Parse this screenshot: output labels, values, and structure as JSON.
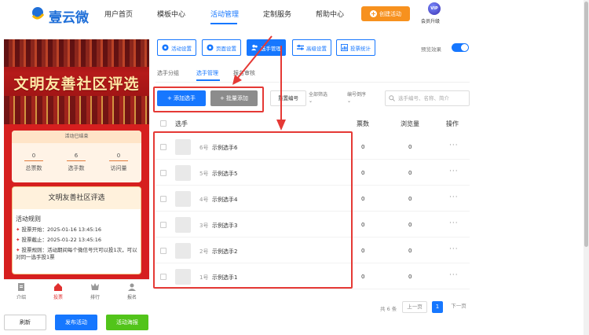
{
  "brand": {
    "name": "壹云微"
  },
  "nav": {
    "items": [
      "用户首页",
      "模板中心",
      "活动管理",
      "定制服务",
      "帮助中心"
    ],
    "active_index": 2,
    "create_label": "创建活动",
    "vip_badge": "VIP",
    "vip_label": "会员升级"
  },
  "preview": {
    "banner_title": "文明友善社区评选",
    "status": "活动已结束",
    "stats": [
      {
        "value": "0",
        "label": "总票数"
      },
      {
        "value": "6",
        "label": "选手数"
      },
      {
        "value": "0",
        "label": "访问量"
      }
    ],
    "rules_title": "文明友善社区评选",
    "rules_label": "活动规则",
    "rules": [
      "投票开始：2025-01-16 13:45:16",
      "投票截止：2025-01-22 13:45:16",
      "投票规则：活动期间每个微信号只可以投1次，可以对同一选手投1票"
    ],
    "tabs": [
      "介绍",
      "投票",
      "排行",
      "报名"
    ],
    "active_tab": 1
  },
  "bottom_buttons": {
    "refresh": "刷新",
    "publish": "发布活动",
    "poster": "活动海报"
  },
  "settings_buttons": [
    "活动设置",
    "页面设置",
    "选手管理",
    "高级设置",
    "投票统计"
  ],
  "settings_active": 2,
  "preview_effect": {
    "label": "预览效果",
    "on": true
  },
  "subtabs": [
    "选手分组",
    "选手管理",
    "报名审核"
  ],
  "subtab_active": 1,
  "actions": {
    "add": "+ 添加选手",
    "batch": "+ 批量添加",
    "reorder": "重置编号",
    "filter": "全部筛选",
    "sort": "编号倒序",
    "search_placeholder": "选手编号、名称、简介"
  },
  "table": {
    "headers": {
      "player": "选手",
      "votes": "票数",
      "views": "浏览量",
      "ops": "操作"
    },
    "rows": [
      {
        "no": "6号",
        "name": "示例选手6",
        "votes": "0",
        "views": "0",
        "more": "···"
      },
      {
        "no": "5号",
        "name": "示例选手5",
        "votes": "0",
        "views": "0",
        "more": "···"
      },
      {
        "no": "4号",
        "name": "示例选手4",
        "votes": "0",
        "views": "0",
        "more": "···"
      },
      {
        "no": "3号",
        "name": "示例选手3",
        "votes": "0",
        "views": "0",
        "more": "···"
      },
      {
        "no": "2号",
        "name": "示例选手2",
        "votes": "0",
        "views": "0",
        "more": "···"
      },
      {
        "no": "1号",
        "name": "示例选手1",
        "votes": "0",
        "views": "0",
        "more": "···"
      }
    ]
  },
  "pagination": {
    "total": "共 6 条",
    "prev": "上一页",
    "current": "1",
    "next": "下一页"
  },
  "colors": {
    "primary": "#1677ff",
    "accent": "#f7911e",
    "annotation": "#e53935",
    "success": "#52c41a"
  }
}
